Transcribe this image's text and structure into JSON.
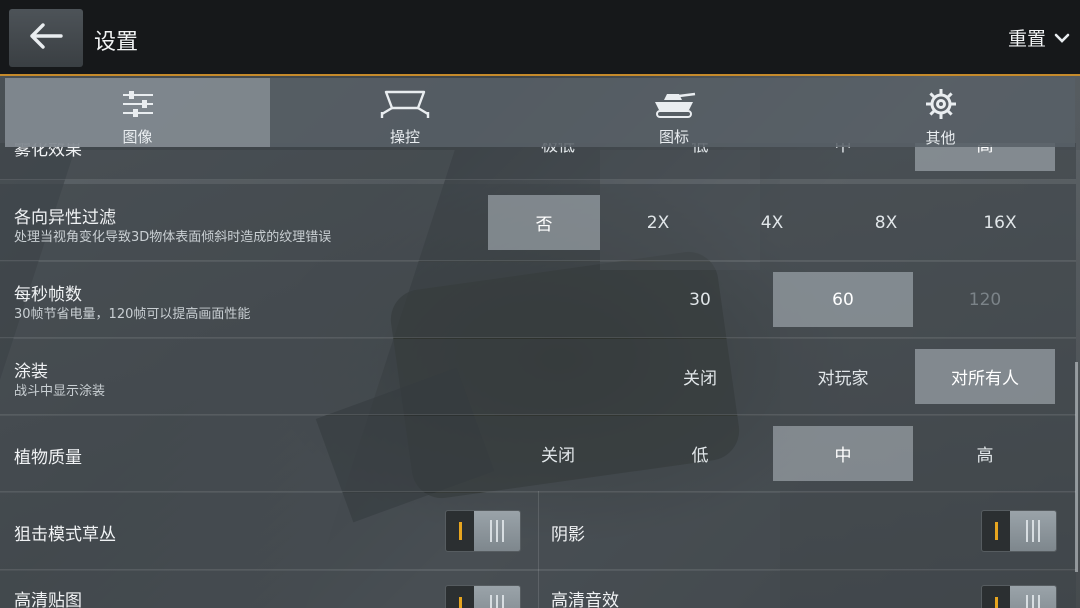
{
  "header": {
    "title": "设置",
    "reset_label": "重置"
  },
  "tabs": [
    {
      "label": "图像",
      "icon": "sliders-icon",
      "active": true
    },
    {
      "label": "操控",
      "icon": "controls-icon",
      "active": false
    },
    {
      "label": "图标",
      "icon": "tank-icon",
      "active": false
    },
    {
      "label": "其他",
      "icon": "gear-icon",
      "active": false
    }
  ],
  "settings": {
    "fog": {
      "title": "雾化效果",
      "options": [
        "极低",
        "低",
        "中",
        "高"
      ],
      "selected": "高"
    },
    "anisotropic": {
      "title": "各向异性过滤",
      "subtitle": "处理当视角变化导致3D物体表面倾斜时造成的纹理错误",
      "options": [
        "否",
        "2X",
        "4X",
        "8X",
        "16X"
      ],
      "selected": "否"
    },
    "fps": {
      "title": "每秒帧数",
      "subtitle": "30帧节省电量，120帧可以提高画面性能",
      "options": [
        "30",
        "60",
        "120"
      ],
      "selected": "60",
      "disabled": [
        "120"
      ]
    },
    "camo": {
      "title": "涂装",
      "subtitle": "战斗中显示涂装",
      "options": [
        "关闭",
        "对玩家",
        "对所有人"
      ],
      "selected": "对所有人"
    },
    "vegetation": {
      "title": "植物质量",
      "options": [
        "关闭",
        "低",
        "中",
        "高"
      ],
      "selected": "中"
    },
    "toggles": [
      {
        "label": "狙击模式草丛",
        "on": true
      },
      {
        "label": "阴影",
        "on": true
      },
      {
        "label": "高清贴图",
        "on": true
      },
      {
        "label": "高清音效",
        "on": true
      }
    ]
  },
  "colors": {
    "accent": "#c58a2b",
    "toggle_on": "#e7a51f",
    "topbar": "#16181a"
  }
}
